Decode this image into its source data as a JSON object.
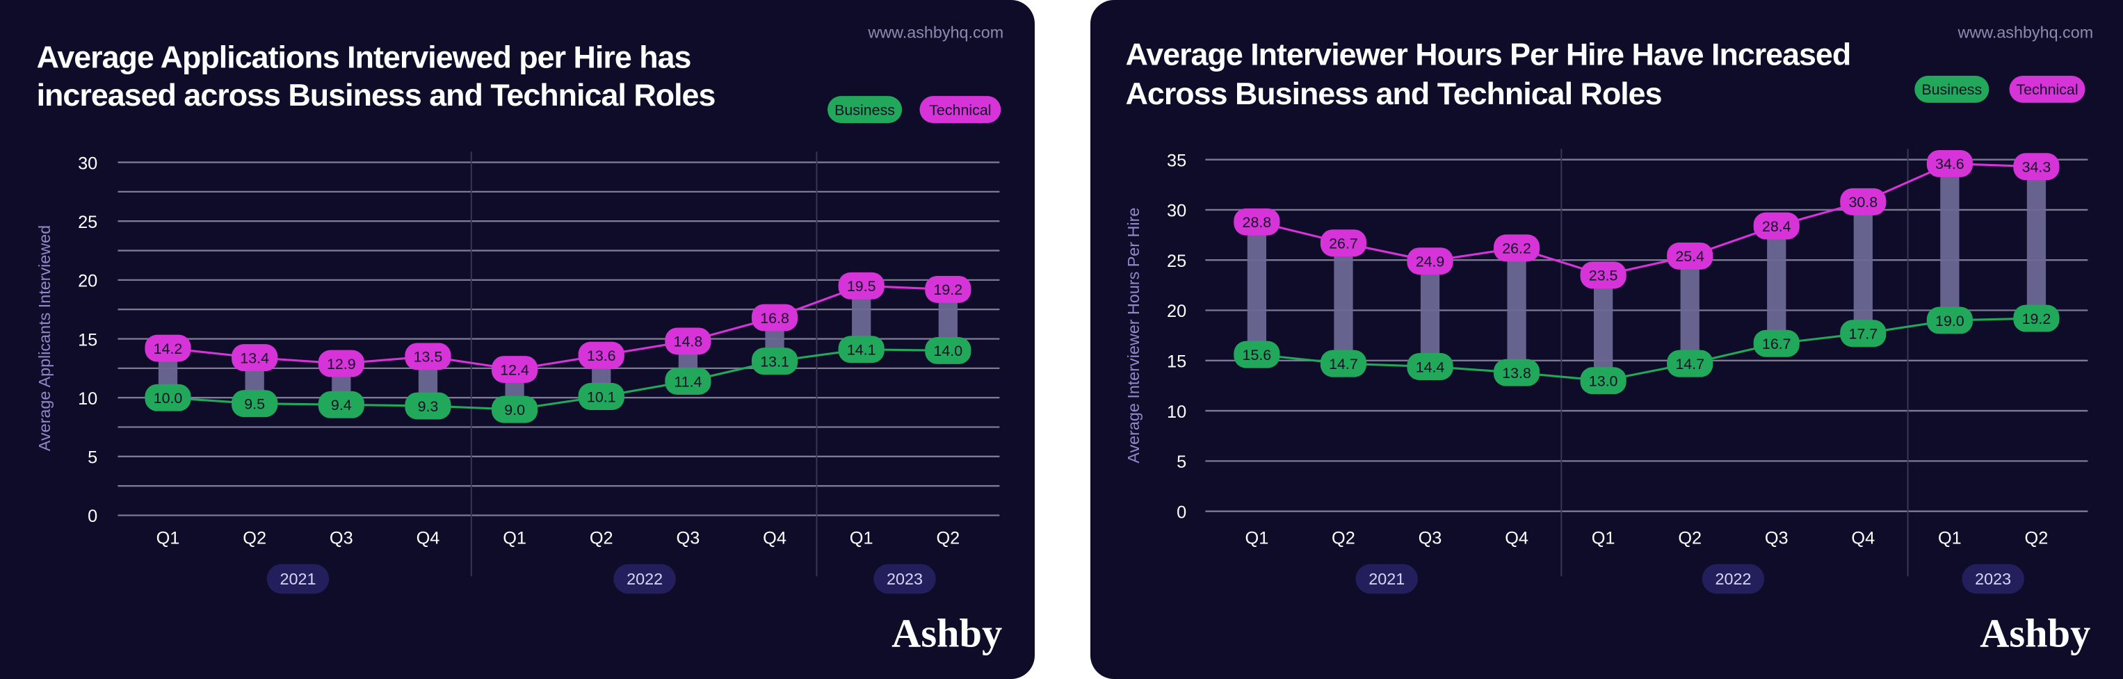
{
  "chart_data": [
    {
      "type": "line",
      "title_lines": [
        "Average Applications Interviewed per Hire has",
        "increased across Business and Technical Roles"
      ],
      "url": "www.ashbyhq.com",
      "xlabel": "",
      "ylabel": "Average Applicants Interviewed",
      "ylim": [
        0,
        30
      ],
      "yticks": [
        0,
        5,
        10,
        15,
        20,
        25,
        30
      ],
      "grid_step": 2.5,
      "categories": [
        "Q1",
        "Q2",
        "Q3",
        "Q4",
        "Q1",
        "Q2",
        "Q3",
        "Q4",
        "Q1",
        "Q2"
      ],
      "years": [
        {
          "label": "2021",
          "start": 0,
          "end": 3
        },
        {
          "label": "2022",
          "start": 4,
          "end": 7
        },
        {
          "label": "2023",
          "start": 8,
          "end": 9
        }
      ],
      "series": [
        {
          "name": "Business",
          "color": "#22a85a",
          "values": [
            10.0,
            9.5,
            9.4,
            9.3,
            9.0,
            10.1,
            11.4,
            13.1,
            14.1,
            14.0
          ],
          "labels": [
            "10.0",
            "9.5",
            "9.4",
            "9.3",
            "9.0",
            "10.1",
            "11.4",
            "13.1",
            "14.1",
            "14.0"
          ]
        },
        {
          "name": "Technical",
          "color": "#d633d8",
          "values": [
            14.2,
            13.4,
            12.9,
            13.5,
            12.4,
            13.6,
            14.8,
            16.8,
            19.5,
            19.2
          ],
          "labels": [
            "14.2",
            "13.4",
            "12.9",
            "13.5",
            "12.4",
            "13.6",
            "14.8",
            "16.8",
            "19.5",
            "19.2"
          ]
        }
      ],
      "legend": [
        "Business",
        "Technical"
      ],
      "legend_position": "top-right",
      "logo": "Ashby"
    },
    {
      "type": "line",
      "title_lines": [
        "Average Interviewer Hours Per Hire Have Increased",
        "Across Business and Technical Roles"
      ],
      "url": "www.ashbyhq.com",
      "xlabel": "",
      "ylabel": "Average Interviewer Hours Per Hire",
      "ylim": [
        0,
        35
      ],
      "yticks": [
        0,
        5,
        10,
        15,
        20,
        25,
        30,
        35
      ],
      "grid_step": 5,
      "categories": [
        "Q1",
        "Q2",
        "Q3",
        "Q4",
        "Q1",
        "Q2",
        "Q3",
        "Q4",
        "Q1",
        "Q2"
      ],
      "years": [
        {
          "label": "2021",
          "start": 0,
          "end": 3
        },
        {
          "label": "2022",
          "start": 4,
          "end": 7
        },
        {
          "label": "2023",
          "start": 8,
          "end": 9
        }
      ],
      "series": [
        {
          "name": "Business",
          "color": "#22a85a",
          "values": [
            15.6,
            14.7,
            14.4,
            13.8,
            13.0,
            14.7,
            16.7,
            17.7,
            19.0,
            19.2
          ],
          "labels": [
            "15.6",
            "14.7",
            "14.4",
            "13.8",
            "13.0",
            "14.7",
            "16.7",
            "17.7",
            "19.0",
            "19.2"
          ]
        },
        {
          "name": "Technical",
          "color": "#d633d8",
          "values": [
            28.8,
            26.7,
            24.9,
            26.2,
            23.5,
            25.4,
            28.4,
            30.8,
            34.6,
            34.3
          ],
          "labels": [
            "28.8",
            "26.7",
            "24.9",
            "26.2",
            "23.5",
            "25.4",
            "28.4",
            "30.8",
            "34.6",
            "34.3"
          ]
        }
      ],
      "legend": [
        "Business",
        "Technical"
      ],
      "legend_position": "top-right",
      "logo": "Ashby"
    }
  ],
  "colors": {
    "background": "#0e0c28",
    "business": "#22a85a",
    "technical": "#d633d8",
    "range_bar": "#6b6894",
    "year_pill": "#221f5c"
  }
}
